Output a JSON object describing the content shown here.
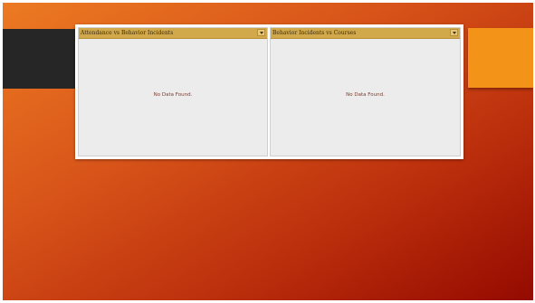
{
  "panels": [
    {
      "title": "Attendance vs Behavior Incidents",
      "empty_message": "No Data Found."
    },
    {
      "title": "Behavior Incidents vs Courses",
      "empty_message": "No Data Found."
    }
  ],
  "colors": {
    "header": "#d1a94a",
    "panel_background": "#ececec",
    "slide_gradient_start": "#ec7a22",
    "slide_gradient_end": "#940a00",
    "dark_band": "#262626",
    "orange_band": "#f39419"
  },
  "icons": {
    "panel_menu": "chevron-down-icon"
  }
}
